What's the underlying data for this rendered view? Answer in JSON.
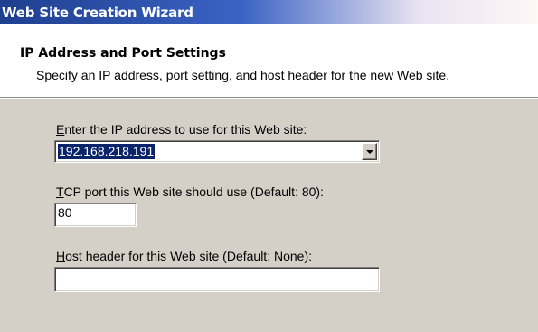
{
  "window": {
    "title": "Web Site Creation Wizard"
  },
  "header": {
    "heading": "IP Address and Port Settings",
    "subheading": "Specify an IP address, port setting, and host header for the new Web site."
  },
  "form": {
    "ip": {
      "label_mnemonic": "E",
      "label_rest": "nter the IP address to use for this Web site:",
      "value": "192.168.218.191",
      "dropdown_icon": "chevron-down-icon"
    },
    "port": {
      "label_mnemonic": "T",
      "label_rest": "CP port this Web site should use (Default: 80):",
      "value": "80"
    },
    "host": {
      "label_mnemonic": "H",
      "label_rest": "ost header for this Web site (Default: None):",
      "value": ""
    }
  },
  "colors": {
    "titlebar_start": "#1f3f8f",
    "dialog_face": "#d4d0c8",
    "selection": "#0a246a"
  }
}
